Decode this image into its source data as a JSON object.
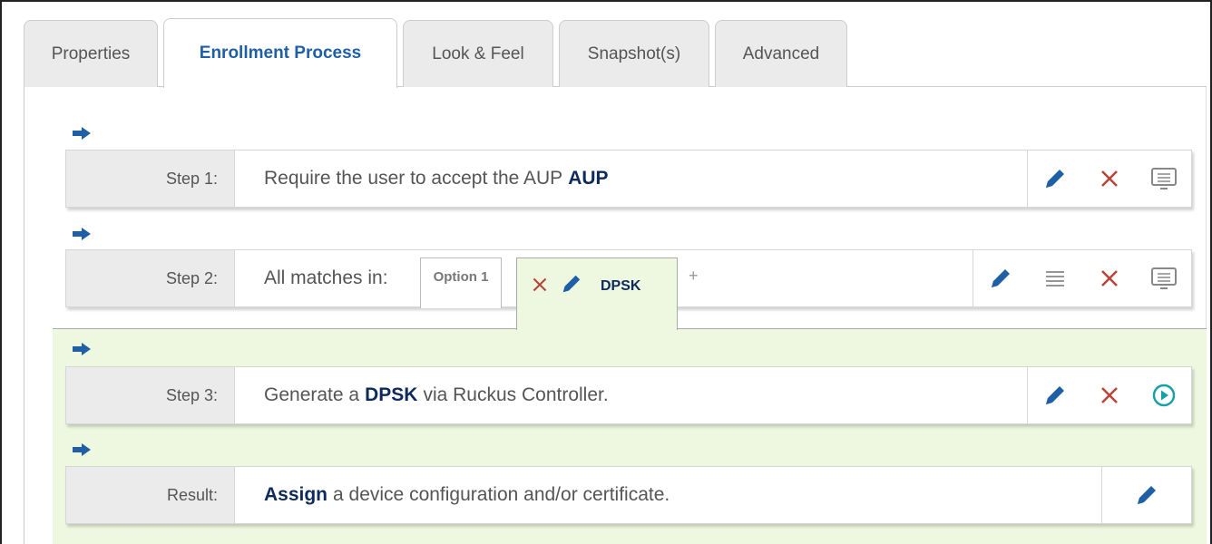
{
  "tabs": [
    {
      "label": "Properties",
      "active": false
    },
    {
      "label": "Enrollment Process",
      "active": true
    },
    {
      "label": "Look & Feel",
      "active": false
    },
    {
      "label": "Snapshot(s)",
      "active": false
    },
    {
      "label": "Advanced",
      "active": false
    }
  ],
  "steps": {
    "step1": {
      "label": "Step 1:",
      "text": "Require the user to accept the AUP",
      "keyword": "AUP"
    },
    "step2": {
      "label": "Step 2:",
      "text": "All matches in:",
      "option": "Option 1",
      "branch": "DPSK",
      "add": "+"
    },
    "step3": {
      "label": "Step 3:",
      "prefix": "Generate a",
      "keyword": "DPSK",
      "suffix": "via Ruckus Controller."
    },
    "result": {
      "label": "Result:",
      "keyword": "Assign",
      "text": "a device configuration and/or certificate."
    }
  },
  "colors": {
    "accent": "#1f5fa6",
    "delete": "#b5473a",
    "play": "#13a1a8",
    "highlight": "#eef8e0"
  }
}
